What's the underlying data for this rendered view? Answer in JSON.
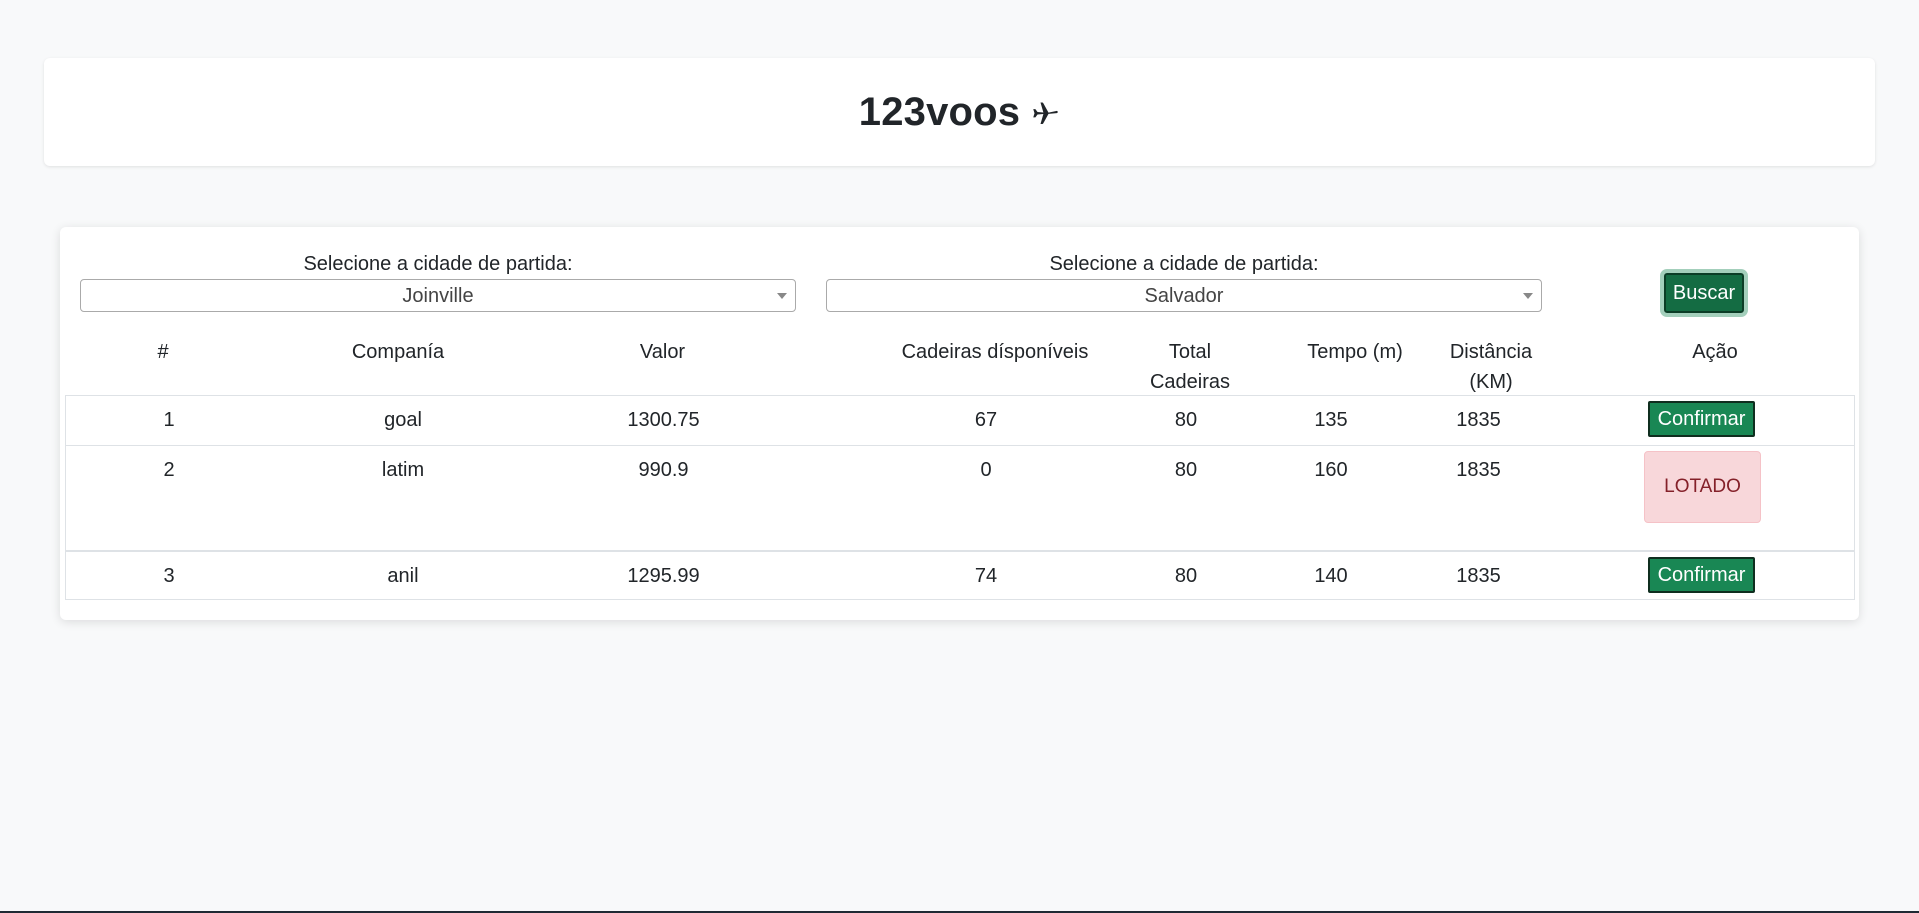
{
  "header": {
    "brand_text": "123voos",
    "brand_icon": "airplane-icon"
  },
  "search": {
    "origin_label": "Selecione a cidade de partida:",
    "origin_value": "Joinville",
    "destination_label": "Selecione a cidade de partida:",
    "destination_value": "Salvador",
    "button_label": "Buscar"
  },
  "table": {
    "columns": [
      "#",
      "Companía",
      "Valor",
      "Cadeiras dísponíveis",
      "Total Cadeiras",
      "Tempo (m)",
      "Distância (KM)",
      "Ação"
    ],
    "rows": [
      {
        "id": "1",
        "company": "goal",
        "price": "1300.75",
        "available": "67",
        "total": "80",
        "time": "135",
        "distance": "1835",
        "action": "Confirmar",
        "status": "available"
      },
      {
        "id": "2",
        "company": "latim",
        "price": "990.9",
        "available": "0",
        "total": "80",
        "time": "160",
        "distance": "1835",
        "action": "LOTADO",
        "status": "full"
      },
      {
        "id": "3",
        "company": "anil",
        "price": "1295.99",
        "available": "74",
        "total": "80",
        "time": "140",
        "distance": "1835",
        "action": "Confirmar",
        "status": "available"
      }
    ]
  },
  "colors": {
    "confirm": "#198754",
    "full_bg": "#f8d7da",
    "full_text": "#842029"
  }
}
